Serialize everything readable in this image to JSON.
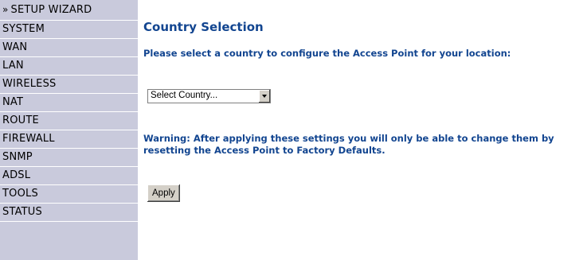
{
  "sidebar": {
    "wizard_chevron": "»",
    "items": [
      {
        "label": "SETUP WIZARD"
      },
      {
        "label": "SYSTEM"
      },
      {
        "label": "WAN"
      },
      {
        "label": "LAN"
      },
      {
        "label": "WIRELESS"
      },
      {
        "label": "NAT"
      },
      {
        "label": "ROUTE"
      },
      {
        "label": "FIREWALL"
      },
      {
        "label": "SNMP"
      },
      {
        "label": "ADSL"
      },
      {
        "label": "TOOLS"
      },
      {
        "label": "STATUS"
      }
    ]
  },
  "main": {
    "title": "Country Selection",
    "intro": "Please select a country to configure the Access Point for your location:",
    "country_select": {
      "value": "Select Country..."
    },
    "warning": "Warning: After applying these settings you will only be able to change them by resetting the Access Point to Factory Defaults.",
    "apply_label": "Apply"
  },
  "colors": {
    "sidebar_bg": "#c9cadc",
    "heading_blue": "#124590"
  }
}
